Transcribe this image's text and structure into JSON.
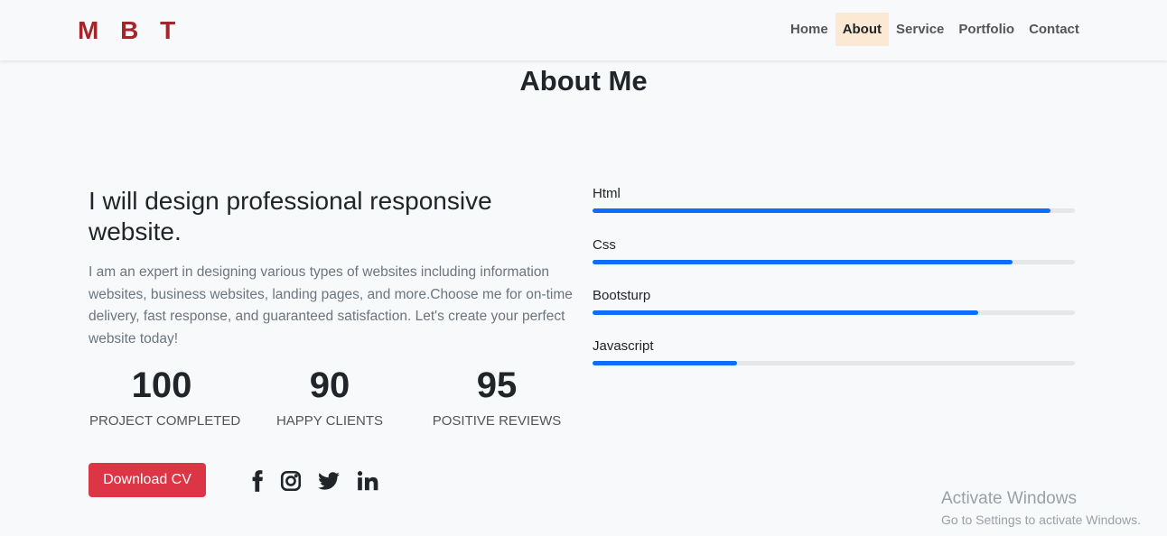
{
  "navbar": {
    "brand": "M B T",
    "links": [
      {
        "label": "Home",
        "active": false
      },
      {
        "label": "About",
        "active": true
      },
      {
        "label": "Service",
        "active": false
      },
      {
        "label": "Portfolio",
        "active": false
      },
      {
        "label": "Contact",
        "active": false
      }
    ]
  },
  "about": {
    "title": "About Me",
    "headline": "I will design professional responsive website.",
    "description": "I am an expert in designing various types of websites including information websites, business websites, landing pages, and more.Choose me for on-time delivery, fast response, and guaranteed satisfaction. Let's create your perfect website today!",
    "stats": [
      {
        "value": "100",
        "label": "PROJECT COMPLETED"
      },
      {
        "value": "90",
        "label": "HAPPY CLIENTS"
      },
      {
        "value": "95",
        "label": "POSITIVE REVIEWS"
      }
    ],
    "download_label": "Download CV",
    "social": [
      "facebook-icon",
      "instagram-icon",
      "twitter-icon",
      "linkedin-icon"
    ]
  },
  "skills": [
    {
      "name": "Html",
      "percent": 95
    },
    {
      "name": "Css",
      "percent": 87
    },
    {
      "name": "Bootsturp",
      "percent": 80
    },
    {
      "name": "Javascript",
      "percent": 30
    }
  ],
  "colors": {
    "brand": "#a3262b",
    "active_tab_bg": "#fbe9d4",
    "progress": "#0d6efd",
    "button": "#dc3545"
  },
  "watermark": {
    "title": "Activate Windows",
    "subtitle": "Go to Settings to activate Windows."
  }
}
